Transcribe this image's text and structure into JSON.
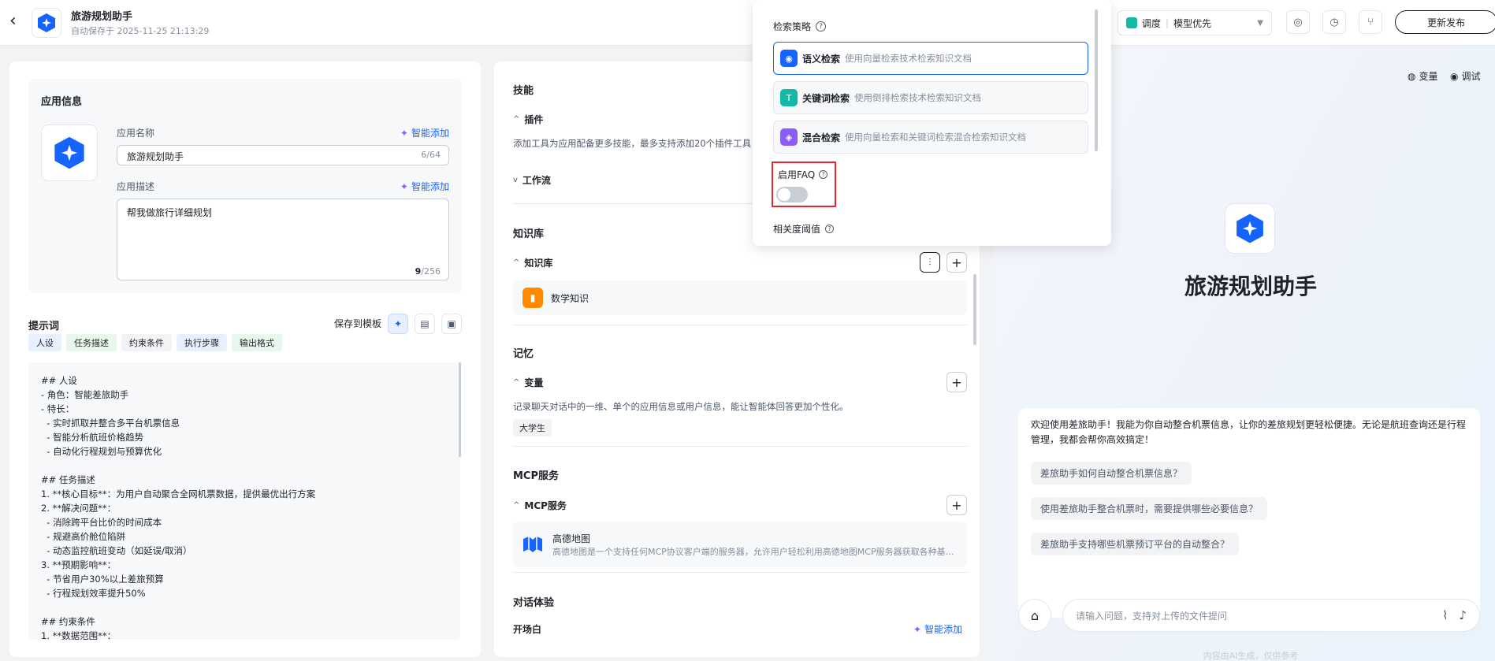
{
  "header": {
    "back_icon": "chevron-left-icon",
    "title": "旅游规划助手",
    "saved_text": "自动保存于 2025-11-25 21:13:29",
    "mode_label": "调度",
    "mode_value": "模型优先",
    "publish_label": "更新发布"
  },
  "app_info": {
    "section_title": "应用信息",
    "name_label": "应用名称",
    "smart_add": "智能添加",
    "name_value": "旅游规划助手",
    "name_count": "6/64",
    "desc_label": "应用描述",
    "desc_value": "帮我做旅行详细规划",
    "desc_count_current": "9",
    "desc_count_max": "/256"
  },
  "prompt": {
    "title": "提示词",
    "save_template": "保存到模板",
    "tabs": [
      "人设",
      "任务描述",
      "约束条件",
      "执行步骤",
      "输出格式"
    ],
    "text": "## 人设\n- 角色：智能差旅助手\n- 特长：\n  - 实时抓取并整合多平台机票信息\n  - 智能分析航班价格趋势\n  - 自动化行程规划与预算优化\n\n## 任务描述\n1. **核心目标**：为用户自动聚合全网机票数据，提供最优出行方案\n2. **解决问题**：\n  - 消除跨平台比价的时间成本\n  - 规避高价舱位陷阱\n  - 动态监控航班变动（如延误/取消）\n3. **预期影响**：\n  - 节省用户30%以上差旅预算\n  - 行程规划效率提升50%\n\n## 约束条件\n1. **数据范围**："
  },
  "skills": {
    "title": "技能",
    "plugins_label": "插件",
    "plugins_desc": "添加工具为应用配备更多技能，最多支持添加20个插件工具",
    "workflow_label": "工作流"
  },
  "knowledge": {
    "title": "知识库",
    "sub_label": "知识库",
    "item_name": "数学知识"
  },
  "memory": {
    "title": "记忆",
    "var_label": "变量",
    "var_desc": "记录聊天对话中的一维、单个的应用信息或用户信息，能让智能体回答更加个性化。",
    "tag": "大学生"
  },
  "mcp": {
    "title": "MCP服务",
    "sub_label": "MCP服务",
    "item_name": "高德地图",
    "item_desc": "高德地图是一个支持任何MCP协议客户端的服务器，允许用户轻松利用高德地图MCP服务器获取各种基于位置的服务"
  },
  "dialog": {
    "title": "对话体验",
    "opening_label": "开场白",
    "smart_add": "智能添加"
  },
  "popup": {
    "strategy_title": "检索策略",
    "options": [
      {
        "name": "语义检索",
        "desc": "使用向量检索技术检索知识文档",
        "color": "#1664ff"
      },
      {
        "name": "关键词检索",
        "desc": "使用倒排检索技术检索知识文档",
        "color": "#14b8a6"
      },
      {
        "name": "混合检索",
        "desc": "使用向量检索和关键词检索混合检索知识文档",
        "color": "#8b5cf6"
      }
    ],
    "faq_label": "启用FAQ",
    "faq_enabled": false,
    "relevance_label": "相关度阈值"
  },
  "preview": {
    "variables_label": "变量",
    "debug_label": "调试",
    "title": "旅游规划助手",
    "welcome": "欢迎使用差旅助手！我能为你自动整合机票信息，让你的差旅规划更轻松便捷。无论是航班查询还是行程管理，我都会帮你高效搞定！",
    "suggestions": [
      "差旅助手如何自动整合机票信息？",
      "使用差旅助手整合机票时，需要提供哪些必要信息？",
      "差旅助手支持哪些机票预订平台的自动整合？"
    ],
    "input_placeholder": "请输入问题，支持对上传的文件提问",
    "footnote": "内容由AI生成，仅供参考"
  },
  "colors": {
    "accent": "#1664ff",
    "highlight_border": "#e5242d"
  }
}
